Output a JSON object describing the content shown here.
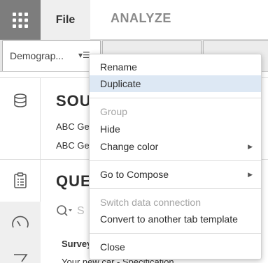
{
  "header": {
    "file_label": "File",
    "analyze_label": "ANALYZE"
  },
  "tabs": {
    "active_label": "Demograp...",
    "menu_glyph": "▾☰",
    "ellipsis": "..."
  },
  "sources": {
    "title": "SOU",
    "lines": [
      "ABC Ge",
      "ABC Ge"
    ]
  },
  "questions": {
    "title": "QUE",
    "search_placeholder": "S",
    "row1": "Survey",
    "row2": "Your new car - Specification"
  },
  "context_menu": {
    "items": [
      {
        "label": "Rename"
      },
      {
        "label": "Duplicate"
      },
      {
        "label": "Group"
      },
      {
        "label": "Hide"
      },
      {
        "label": "Change color"
      },
      {
        "label": "Go to Compose"
      },
      {
        "label": "Switch data connection"
      },
      {
        "label": "Convert to another tab template"
      },
      {
        "label": "Close"
      }
    ]
  },
  "colors": {
    "apps_bg": "#7d7d7d",
    "highlight": "#dde8f4",
    "disabled_text": "#a3a3a3"
  }
}
